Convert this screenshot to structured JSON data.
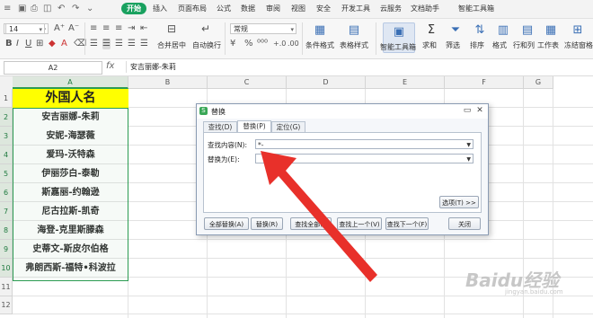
{
  "menubar": {
    "qat_icons": [
      "menu-icon",
      "save-icon",
      "print-icon",
      "preview-icon",
      "undo-icon",
      "redo-icon",
      "dropdown-icon"
    ],
    "tabs": [
      "开始",
      "插入",
      "页面布局",
      "公式",
      "数据",
      "审阅",
      "视图",
      "安全",
      "开发工具",
      "云服务",
      "文档助手",
      "智能工具箱"
    ],
    "active_tab": "开始",
    "accent": "#19a15f"
  },
  "ribbon": {
    "font_name": "",
    "font_size": "14",
    "number_format": "常规",
    "labels": {
      "merge_center": "合并居中",
      "wrap_text": "自动换行",
      "conditional_format": "条件格式",
      "table_style": "表格样式",
      "smart_toolbox": "智能工具箱",
      "sum": "求和",
      "filter": "筛选",
      "sort": "排序",
      "format": "格式",
      "row_col": "行和列",
      "worksheet": "工作表",
      "freeze": "冻结窗格"
    }
  },
  "formula_bar": {
    "name_box": "A2",
    "fx": "fx",
    "content": "安吉丽娜-朱莉"
  },
  "sheet": {
    "columns": [
      "A",
      "B",
      "C",
      "D",
      "E",
      "F",
      "G"
    ],
    "rows": [
      "1",
      "2",
      "3",
      "4",
      "5",
      "6",
      "7",
      "8",
      "9",
      "10",
      "11",
      "12"
    ],
    "header": "外国人名",
    "names": [
      "安吉丽娜-朱莉",
      "安妮-海瑟薇",
      "爱玛-沃特森",
      "伊丽莎白-泰勒",
      "斯嘉丽-约翰逊",
      "尼古拉斯-凯奇",
      "海登-克里斯滕森",
      "史蒂文-斯皮尔伯格",
      "弗朗西斯-福特•科波拉"
    ],
    "header_fill": "#ffff00",
    "selection_color": "#2b9b52"
  },
  "dialog": {
    "title": "替换",
    "tabs": [
      "查找(D)",
      "替换(P)",
      "定位(G)"
    ],
    "active_tab": "替换(P)",
    "find_label": "查找内容(N):",
    "find_value": "*-",
    "replace_label": "替换为(E):",
    "replace_value": "",
    "options_button": "选项(T) >>",
    "buttons": [
      "全部替换(A)",
      "替换(R)",
      "查找全部(I)",
      "查找上一个(V)",
      "查找下一个(F)",
      "关闭"
    ]
  },
  "annotation": {
    "arrow_color": "#e8302a"
  },
  "watermark": {
    "text": "Baidu经验",
    "sub": "jingyan.baidu.com"
  }
}
